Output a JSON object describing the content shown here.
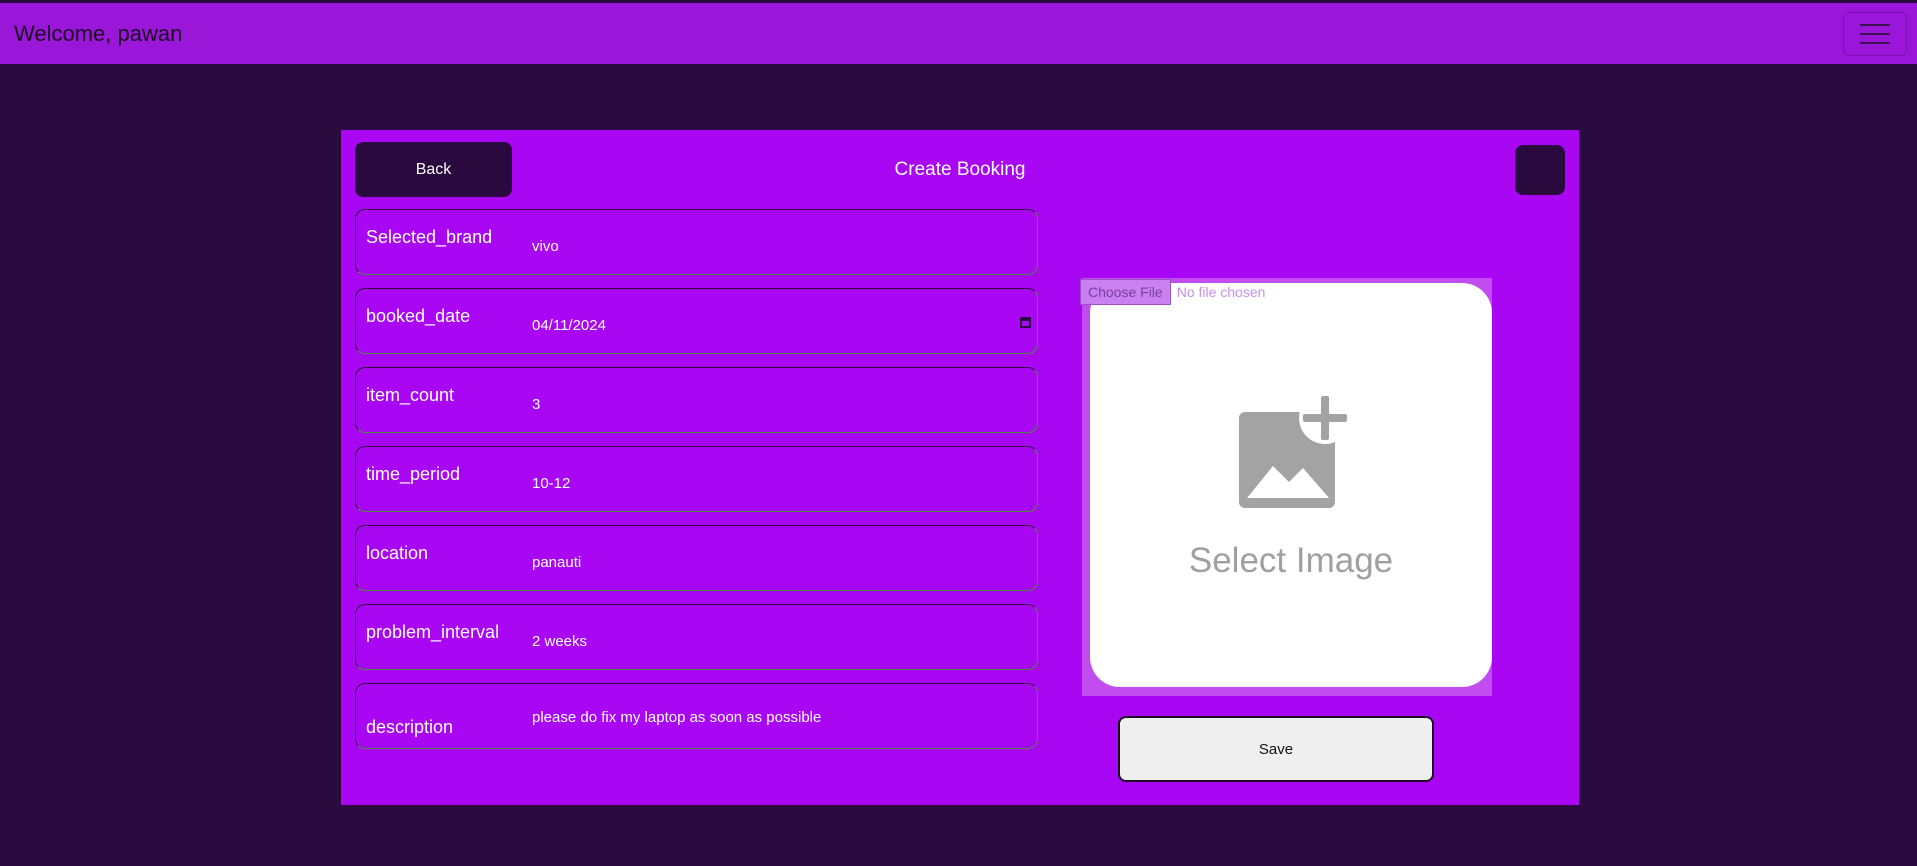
{
  "navbar": {
    "title": "Welcome, pawan",
    "menu_icon": "hamburger-icon"
  },
  "panel": {
    "back_label": "Back",
    "title": "Create Booking"
  },
  "fields": [
    {
      "label": "Selected_brand",
      "value": "vivo"
    },
    {
      "label": "booked_date",
      "value": "04/11/2024"
    },
    {
      "label": "item_count",
      "value": "3"
    },
    {
      "label": "time_period",
      "value": "10-12"
    },
    {
      "label": "location",
      "value": "panauti"
    },
    {
      "label": "problem_interval",
      "value": "2 weeks"
    },
    {
      "label": "description",
      "value": "please do fix my laptop as soon as possible"
    }
  ],
  "file": {
    "button_label": "Choose File",
    "status": "No file chosen"
  },
  "image": {
    "placeholder_text": "Select Image",
    "icon": "add-image-icon"
  },
  "save_label": "Save"
}
